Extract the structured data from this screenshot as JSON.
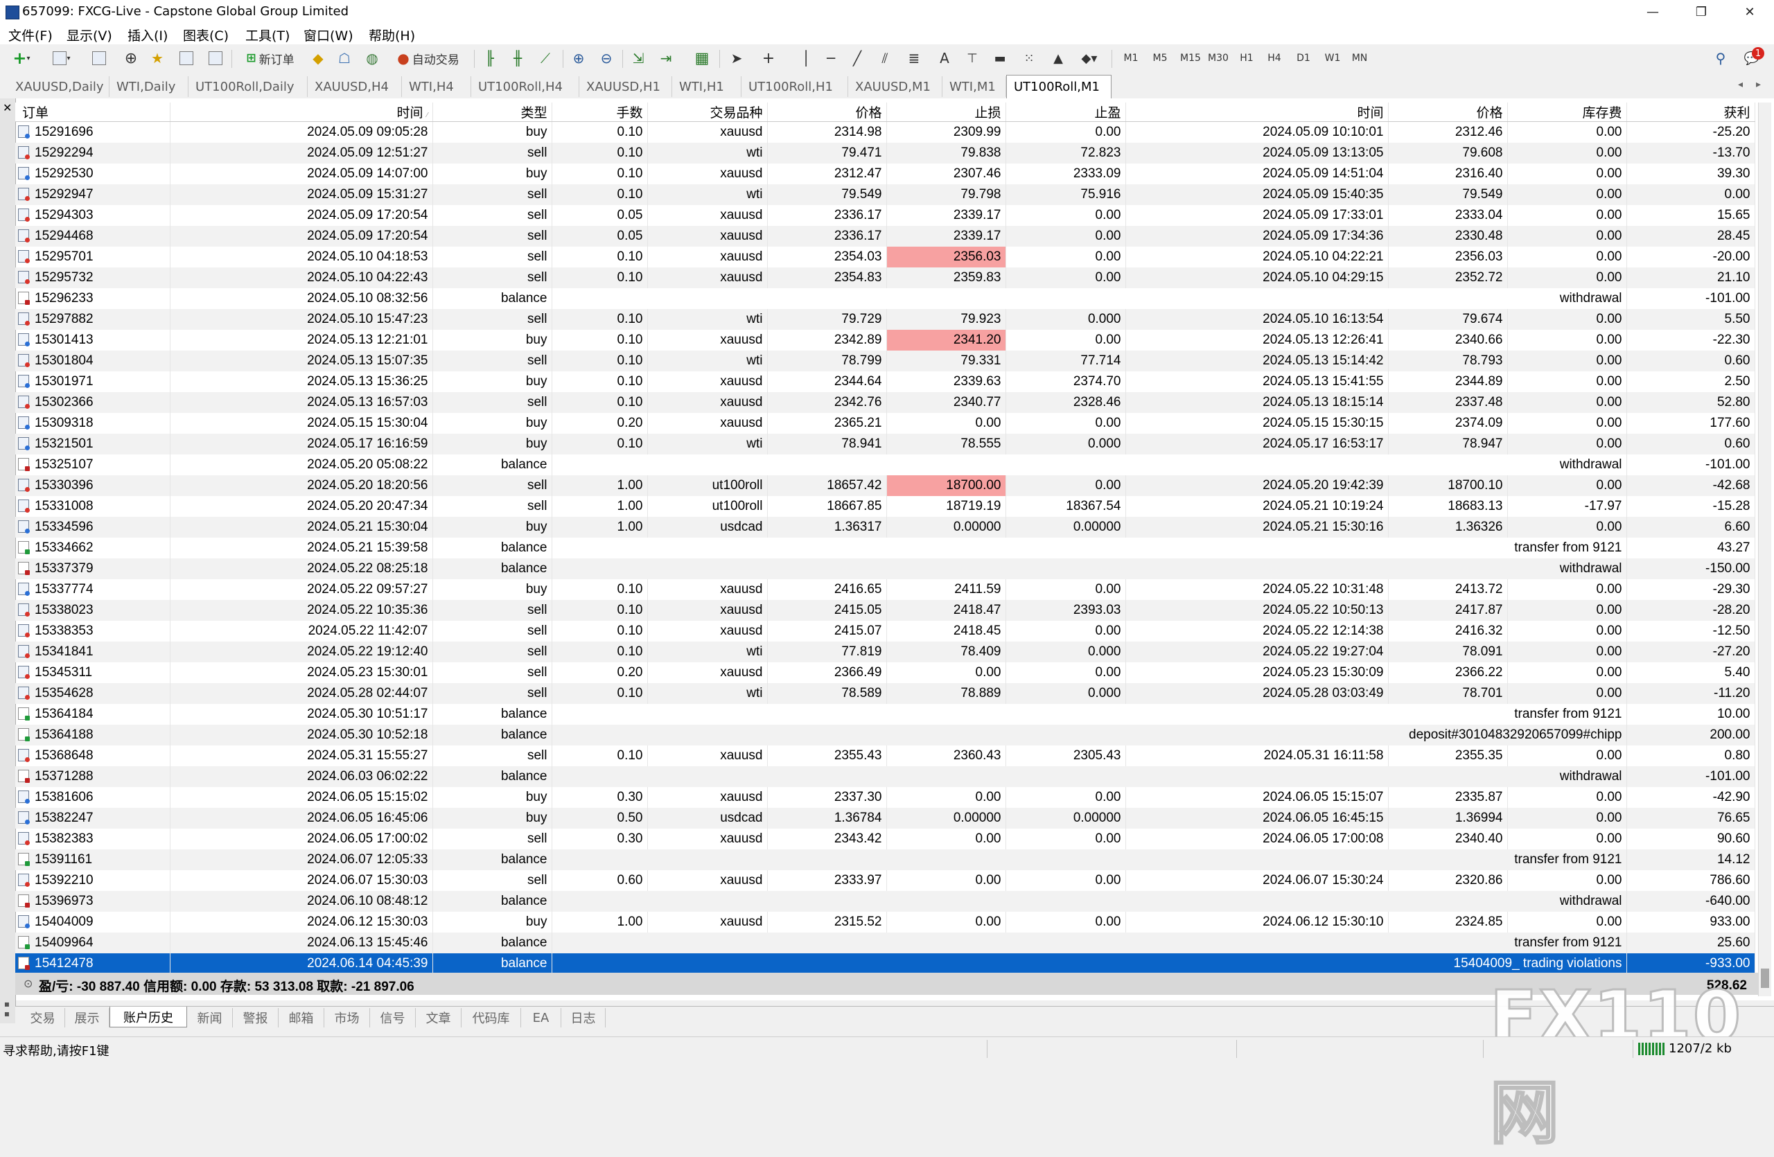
{
  "window": {
    "title": "657099: FXCG-Live - Capstone Global Group Limited",
    "minimize": "—",
    "maximize": "❐",
    "close": "✕"
  },
  "menu": [
    "文件(F)",
    "显示(V)",
    "插入(I)",
    "图表(C)",
    "工具(T)",
    "窗口(W)",
    "帮助(H)"
  ],
  "toolbar": {
    "new_order_label": "新订单",
    "auto_trade_label": "自动交易",
    "timeframes": [
      "M1",
      "M5",
      "M15",
      "M30",
      "H1",
      "H4",
      "D1",
      "W1",
      "MN"
    ],
    "notification_count": "1"
  },
  "chart_tabs": [
    "XAUUSD,Daily",
    "WTI,Daily",
    "UT100Roll,Daily",
    "XAUUSD,H4",
    "WTI,H4",
    "UT100Roll,H4",
    "XAUUSD,H1",
    "WTI,H1",
    "UT100Roll,H1",
    "XAUUSD,M1",
    "WTI,M1",
    "UT100Roll,M1"
  ],
  "active_chart_tab": "UT100Roll,M1",
  "columns": [
    "订单",
    "时间",
    "类型",
    "手数",
    "交易品种",
    "价格",
    "止损",
    "止盈",
    "时间",
    "价格",
    "库存费",
    "获利"
  ],
  "rows": [
    {
      "order": "15291696",
      "open_time": "2024.05.09 09:05:28",
      "type": "buy",
      "lots": "0.10",
      "symbol": "xauusd",
      "open_price": "2314.98",
      "sl": "2309.99",
      "tp": "0.00",
      "close_time": "2024.05.09 10:10:01",
      "close_price": "2312.46",
      "swap": "0.00",
      "profit": "-25.20"
    },
    {
      "order": "15292294",
      "open_time": "2024.05.09 12:51:27",
      "type": "sell",
      "lots": "0.10",
      "symbol": "wti",
      "open_price": "79.471",
      "sl": "79.838",
      "tp": "72.823",
      "close_time": "2024.05.09 13:13:05",
      "close_price": "79.608",
      "swap": "0.00",
      "profit": "-13.70"
    },
    {
      "order": "15292530",
      "open_time": "2024.05.09 14:07:00",
      "type": "buy",
      "lots": "0.10",
      "symbol": "xauusd",
      "open_price": "2312.47",
      "sl": "2307.46",
      "tp": "2333.09",
      "close_time": "2024.05.09 14:51:04",
      "close_price": "2316.40",
      "swap": "0.00",
      "profit": "39.30"
    },
    {
      "order": "15292947",
      "open_time": "2024.05.09 15:31:27",
      "type": "sell",
      "lots": "0.10",
      "symbol": "wti",
      "open_price": "79.549",
      "sl": "79.798",
      "tp": "75.916",
      "close_time": "2024.05.09 15:40:35",
      "close_price": "79.549",
      "swap": "0.00",
      "profit": "0.00"
    },
    {
      "order": "15294303",
      "open_time": "2024.05.09 17:20:54",
      "type": "sell",
      "lots": "0.05",
      "symbol": "xauusd",
      "open_price": "2336.17",
      "sl": "2339.17",
      "tp": "0.00",
      "close_time": "2024.05.09 17:33:01",
      "close_price": "2333.04",
      "swap": "0.00",
      "profit": "15.65"
    },
    {
      "order": "15294468",
      "open_time": "2024.05.09 17:20:54",
      "type": "sell",
      "lots": "0.05",
      "symbol": "xauusd",
      "open_price": "2336.17",
      "sl": "2339.17",
      "tp": "0.00",
      "close_time": "2024.05.09 17:34:36",
      "close_price": "2330.48",
      "swap": "0.00",
      "profit": "28.45"
    },
    {
      "order": "15295701",
      "open_time": "2024.05.10 04:18:53",
      "type": "sell",
      "lots": "0.10",
      "symbol": "xauusd",
      "open_price": "2354.03",
      "sl": "2356.03",
      "tp": "0.00",
      "close_time": "2024.05.10 04:22:21",
      "close_price": "2356.03",
      "swap": "0.00",
      "profit": "-20.00",
      "sl_hit": true
    },
    {
      "order": "15295732",
      "open_time": "2024.05.10 04:22:43",
      "type": "sell",
      "lots": "0.10",
      "symbol": "xauusd",
      "open_price": "2354.83",
      "sl": "2359.83",
      "tp": "0.00",
      "close_time": "2024.05.10 04:29:15",
      "close_price": "2352.72",
      "swap": "0.00",
      "profit": "21.10"
    },
    {
      "order": "15296233",
      "open_time": "2024.05.10 08:32:56",
      "type": "balance",
      "comment": "withdrawal",
      "profit": "-101.00"
    },
    {
      "order": "15297882",
      "open_time": "2024.05.10 15:47:23",
      "type": "sell",
      "lots": "0.10",
      "symbol": "wti",
      "open_price": "79.729",
      "sl": "79.923",
      "tp": "0.000",
      "close_time": "2024.05.10 16:13:54",
      "close_price": "79.674",
      "swap": "0.00",
      "profit": "5.50"
    },
    {
      "order": "15301413",
      "open_time": "2024.05.13 12:21:01",
      "type": "buy",
      "lots": "0.10",
      "symbol": "xauusd",
      "open_price": "2342.89",
      "sl": "2341.20",
      "tp": "0.00",
      "close_time": "2024.05.13 12:26:41",
      "close_price": "2340.66",
      "swap": "0.00",
      "profit": "-22.30",
      "sl_hit": true
    },
    {
      "order": "15301804",
      "open_time": "2024.05.13 15:07:35",
      "type": "sell",
      "lots": "0.10",
      "symbol": "wti",
      "open_price": "78.799",
      "sl": "79.331",
      "tp": "77.714",
      "close_time": "2024.05.13 15:14:42",
      "close_price": "78.793",
      "swap": "0.00",
      "profit": "0.60"
    },
    {
      "order": "15301971",
      "open_time": "2024.05.13 15:36:25",
      "type": "buy",
      "lots": "0.10",
      "symbol": "xauusd",
      "open_price": "2344.64",
      "sl": "2339.63",
      "tp": "2374.70",
      "close_time": "2024.05.13 15:41:55",
      "close_price": "2344.89",
      "swap": "0.00",
      "profit": "2.50"
    },
    {
      "order": "15302366",
      "open_time": "2024.05.13 16:57:03",
      "type": "sell",
      "lots": "0.10",
      "symbol": "xauusd",
      "open_price": "2342.76",
      "sl": "2340.77",
      "tp": "2328.46",
      "close_time": "2024.05.13 18:15:14",
      "close_price": "2337.48",
      "swap": "0.00",
      "profit": "52.80"
    },
    {
      "order": "15309318",
      "open_time": "2024.05.15 15:30:04",
      "type": "buy",
      "lots": "0.20",
      "symbol": "xauusd",
      "open_price": "2365.21",
      "sl": "0.00",
      "tp": "0.00",
      "close_time": "2024.05.15 15:30:15",
      "close_price": "2374.09",
      "swap": "0.00",
      "profit": "177.60"
    },
    {
      "order": "15321501",
      "open_time": "2024.05.17 16:16:59",
      "type": "buy",
      "lots": "0.10",
      "symbol": "wti",
      "open_price": "78.941",
      "sl": "78.555",
      "tp": "0.000",
      "close_time": "2024.05.17 16:53:17",
      "close_price": "78.947",
      "swap": "0.00",
      "profit": "0.60"
    },
    {
      "order": "15325107",
      "open_time": "2024.05.20 05:08:22",
      "type": "balance",
      "comment": "withdrawal",
      "profit": "-101.00"
    },
    {
      "order": "15330396",
      "open_time": "2024.05.20 18:20:56",
      "type": "sell",
      "lots": "1.00",
      "symbol": "ut100roll",
      "open_price": "18657.42",
      "sl": "18700.00",
      "tp": "0.00",
      "close_time": "2024.05.20 19:42:39",
      "close_price": "18700.10",
      "swap": "0.00",
      "profit": "-42.68",
      "sl_hit": true
    },
    {
      "order": "15331008",
      "open_time": "2024.05.20 20:47:34",
      "type": "sell",
      "lots": "1.00",
      "symbol": "ut100roll",
      "open_price": "18667.85",
      "sl": "18719.19",
      "tp": "18367.54",
      "close_time": "2024.05.21 10:19:24",
      "close_price": "18683.13",
      "swap": "-17.97",
      "profit": "-15.28"
    },
    {
      "order": "15334596",
      "open_time": "2024.05.21 15:30:04",
      "type": "buy",
      "lots": "1.00",
      "symbol": "usdcad",
      "open_price": "1.36317",
      "sl": "0.00000",
      "tp": "0.00000",
      "close_time": "2024.05.21 15:30:16",
      "close_price": "1.36326",
      "swap": "0.00",
      "profit": "6.60"
    },
    {
      "order": "15334662",
      "open_time": "2024.05.21 15:39:58",
      "type": "balance",
      "comment": "transfer from 9121",
      "profit": "43.27"
    },
    {
      "order": "15337379",
      "open_time": "2024.05.22 08:25:18",
      "type": "balance",
      "comment": "withdrawal",
      "profit": "-150.00"
    },
    {
      "order": "15337774",
      "open_time": "2024.05.22 09:57:27",
      "type": "buy",
      "lots": "0.10",
      "symbol": "xauusd",
      "open_price": "2416.65",
      "sl": "2411.59",
      "tp": "0.00",
      "close_time": "2024.05.22 10:31:48",
      "close_price": "2413.72",
      "swap": "0.00",
      "profit": "-29.30"
    },
    {
      "order": "15338023",
      "open_time": "2024.05.22 10:35:36",
      "type": "sell",
      "lots": "0.10",
      "symbol": "xauusd",
      "open_price": "2415.05",
      "sl": "2418.47",
      "tp": "2393.03",
      "close_time": "2024.05.22 10:50:13",
      "close_price": "2417.87",
      "swap": "0.00",
      "profit": "-28.20"
    },
    {
      "order": "15338353",
      "open_time": "2024.05.22 11:42:07",
      "type": "sell",
      "lots": "0.10",
      "symbol": "xauusd",
      "open_price": "2415.07",
      "sl": "2418.45",
      "tp": "0.00",
      "close_time": "2024.05.22 12:14:38",
      "close_price": "2416.32",
      "swap": "0.00",
      "profit": "-12.50"
    },
    {
      "order": "15341841",
      "open_time": "2024.05.22 19:12:40",
      "type": "sell",
      "lots": "0.10",
      "symbol": "wti",
      "open_price": "77.819",
      "sl": "78.409",
      "tp": "0.000",
      "close_time": "2024.05.22 19:27:04",
      "close_price": "78.091",
      "swap": "0.00",
      "profit": "-27.20"
    },
    {
      "order": "15345311",
      "open_time": "2024.05.23 15:30:01",
      "type": "sell",
      "lots": "0.20",
      "symbol": "xauusd",
      "open_price": "2366.49",
      "sl": "0.00",
      "tp": "0.00",
      "close_time": "2024.05.23 15:30:09",
      "close_price": "2366.22",
      "swap": "0.00",
      "profit": "5.40"
    },
    {
      "order": "15354628",
      "open_time": "2024.05.28 02:44:07",
      "type": "sell",
      "lots": "0.10",
      "symbol": "wti",
      "open_price": "78.589",
      "sl": "78.889",
      "tp": "0.000",
      "close_time": "2024.05.28 03:03:49",
      "close_price": "78.701",
      "swap": "0.00",
      "profit": "-11.20"
    },
    {
      "order": "15364184",
      "open_time": "2024.05.30 10:51:17",
      "type": "balance",
      "comment": "transfer from 9121",
      "profit": "10.00"
    },
    {
      "order": "15364188",
      "open_time": "2024.05.30 10:52:18",
      "type": "balance",
      "comment": "deposit#30104832920657099#chipp",
      "profit": "200.00"
    },
    {
      "order": "15368648",
      "open_time": "2024.05.31 15:55:27",
      "type": "sell",
      "lots": "0.10",
      "symbol": "xauusd",
      "open_price": "2355.43",
      "sl": "2360.43",
      "tp": "2305.43",
      "close_time": "2024.05.31 16:11:58",
      "close_price": "2355.35",
      "swap": "0.00",
      "profit": "0.80"
    },
    {
      "order": "15371288",
      "open_time": "2024.06.03 06:02:22",
      "type": "balance",
      "comment": "withdrawal",
      "profit": "-101.00"
    },
    {
      "order": "15381606",
      "open_time": "2024.06.05 15:15:02",
      "type": "buy",
      "lots": "0.30",
      "symbol": "xauusd",
      "open_price": "2337.30",
      "sl": "0.00",
      "tp": "0.00",
      "close_time": "2024.06.05 15:15:07",
      "close_price": "2335.87",
      "swap": "0.00",
      "profit": "-42.90"
    },
    {
      "order": "15382247",
      "open_time": "2024.06.05 16:45:06",
      "type": "buy",
      "lots": "0.50",
      "symbol": "usdcad",
      "open_price": "1.36784",
      "sl": "0.00000",
      "tp": "0.00000",
      "close_time": "2024.06.05 16:45:15",
      "close_price": "1.36994",
      "swap": "0.00",
      "profit": "76.65"
    },
    {
      "order": "15382383",
      "open_time": "2024.06.05 17:00:02",
      "type": "sell",
      "lots": "0.30",
      "symbol": "xauusd",
      "open_price": "2343.42",
      "sl": "0.00",
      "tp": "0.00",
      "close_time": "2024.06.05 17:00:08",
      "close_price": "2340.40",
      "swap": "0.00",
      "profit": "90.60"
    },
    {
      "order": "15391161",
      "open_time": "2024.06.07 12:05:33",
      "type": "balance",
      "comment": "transfer from 9121",
      "profit": "14.12"
    },
    {
      "order": "15392210",
      "open_time": "2024.06.07 15:30:03",
      "type": "sell",
      "lots": "0.60",
      "symbol": "xauusd",
      "open_price": "2333.97",
      "sl": "0.00",
      "tp": "0.00",
      "close_time": "2024.06.07 15:30:24",
      "close_price": "2320.86",
      "swap": "0.00",
      "profit": "786.60"
    },
    {
      "order": "15396973",
      "open_time": "2024.06.10 08:48:12",
      "type": "balance",
      "comment": "withdrawal",
      "profit": "-640.00"
    },
    {
      "order": "15404009",
      "open_time": "2024.06.12 15:30:03",
      "type": "buy",
      "lots": "1.00",
      "symbol": "xauusd",
      "open_price": "2315.52",
      "sl": "0.00",
      "tp": "0.00",
      "close_time": "2024.06.12 15:30:10",
      "close_price": "2324.85",
      "swap": "0.00",
      "profit": "933.00"
    },
    {
      "order": "15409964",
      "open_time": "2024.06.13 15:45:46",
      "type": "balance",
      "comment": "transfer from 9121",
      "profit": "25.60"
    },
    {
      "order": "15412478",
      "open_time": "2024.06.14 04:45:39",
      "type": "balance",
      "comment": "15404009_ trading violations",
      "profit": "-933.00",
      "selected": true
    }
  ],
  "summary": {
    "text": "盈/亏: -30 887.40  信用额: 0.00  存款: 53 313.08  取款: -21 897.06",
    "total": "528.62"
  },
  "bottom_tabs": [
    "交易",
    "展示",
    "账户历史",
    "新闻",
    "警报",
    "邮箱",
    "市场",
    "信号",
    "文章",
    "代码库",
    "EA",
    "日志"
  ],
  "active_bottom_tab": "账户历史",
  "status": {
    "help": "寻求帮助,请按F1键",
    "traffic": "1207/2 kb"
  },
  "watermark": "FX110网",
  "colors": {
    "selected_row": "#0a64c8",
    "sl_hit_highlight": "#f7a1a1",
    "alt_row": "#f2f2f2"
  }
}
